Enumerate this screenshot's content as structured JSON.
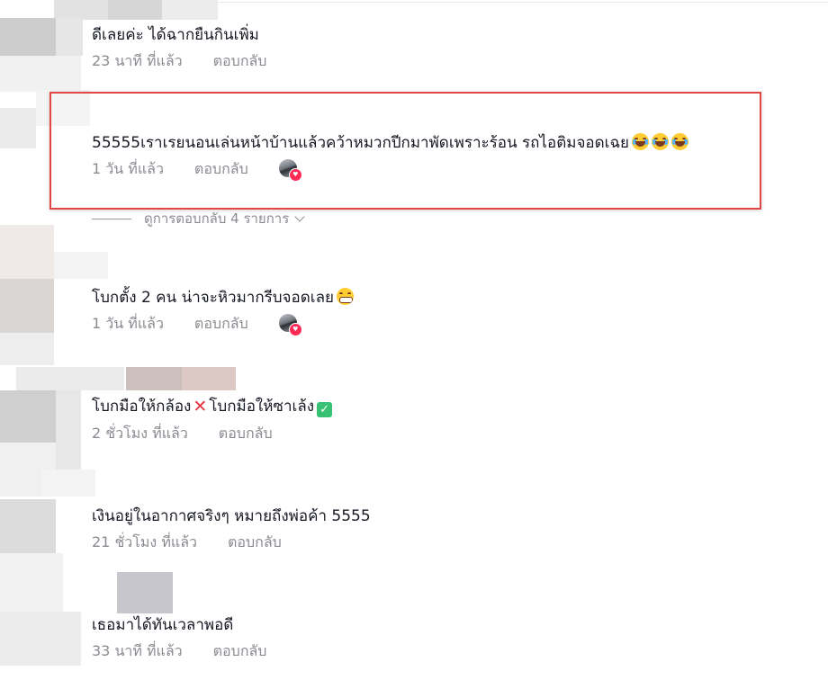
{
  "colors": {
    "text": "#161823",
    "meta": "#8a8b91",
    "highlight_border": "#e04848",
    "heart": "#fe2c55"
  },
  "reply_label": "ตอบกลับ",
  "comments": [
    {
      "text": "ดีเลยค่ะ ได้ฉากยืนกินเพิ่ม",
      "time": "23 นาที ที่แล้ว",
      "reply": "ตอบกลับ",
      "creator_liked": false
    },
    {
      "text": "55555เราเรยนอนเล่นหน้าบ้านแล้วคว้าหมวกปีกมาพัดเพราะร้อน รถไอติมจอดเฉย",
      "emojis": [
        "laugh-cry-emoji",
        "laugh-cry-emoji",
        "laugh-cry-emoji"
      ],
      "time": "1 วัน ที่แล้ว",
      "reply": "ตอบกลับ",
      "creator_liked": true,
      "highlighted": true
    },
    {
      "text": "โบกตั้ง 2 คน น่าจะหิวมากรีบจอดเลย",
      "emojis": [
        "grin-emoji"
      ],
      "time": "1 วัน ที่แล้ว",
      "reply": "ตอบกลับ",
      "creator_liked": true
    },
    {
      "text_a": "โบกมือให้กล้อง",
      "text_b": "โบกมือให้ซาเล้ง",
      "emojis": [
        "cross-mark-emoji",
        "check-mark-emoji"
      ],
      "time": "2 ชั่วโมง ที่แล้ว",
      "reply": "ตอบกลับ",
      "creator_liked": false
    },
    {
      "text": "เงินอยู่ในอากาศจริงๆ หมายถึงพ่อค้า 5555",
      "time": "21 ชั่วโมง ที่แล้ว",
      "reply": "ตอบกลับ",
      "creator_liked": false
    },
    {
      "text": "เธอมาได้ทันเวลาพอดี",
      "time": "33 นาที ที่แล้ว",
      "reply": "ตอบกลับ",
      "creator_liked": false
    }
  ],
  "view_replies": {
    "label": "ดูการตอบกลับ 4 รายการ",
    "icon": "chevron-down-icon"
  }
}
